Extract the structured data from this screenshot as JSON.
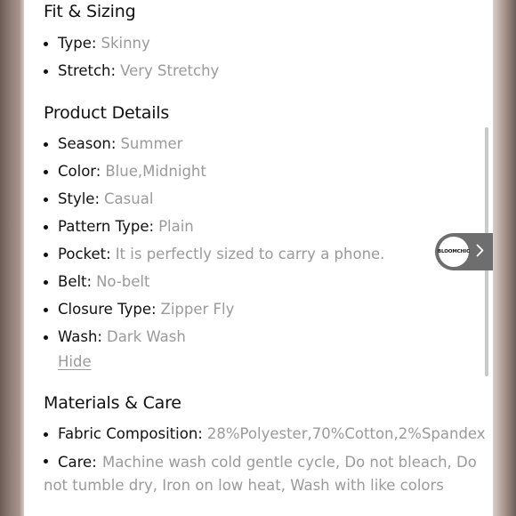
{
  "fit_sizing": {
    "title": "Fit & Sizing",
    "items": [
      {
        "label": "Type:",
        "value": "Skinny"
      },
      {
        "label": "Stretch:",
        "value": "Very Stretchy"
      }
    ]
  },
  "product_details": {
    "title": "Product Details",
    "items": [
      {
        "label": "Season:",
        "value": "Summer"
      },
      {
        "label": "Color:",
        "value": "Blue,Midnight"
      },
      {
        "label": "Style:",
        "value": "Casual"
      },
      {
        "label": "Pattern Type:",
        "value": "Plain"
      },
      {
        "label": "Pocket:",
        "value": "It is perfectly sized to carry a phone."
      },
      {
        "label": "Belt:",
        "value": "No-belt"
      },
      {
        "label": "Closure Type:",
        "value": "Zipper Fly"
      },
      {
        "label": "Wash:",
        "value": "Dark Wash"
      }
    ],
    "hide_label": "Hide"
  },
  "materials_care": {
    "title": "Materials & Care",
    "items": [
      {
        "label": "Fabric Composition:",
        "value": "28%Polyester,70%Cotton,2%Spandex"
      },
      {
        "label": "Care:",
        "value": "Machine wash cold gentle cycle, Do not bleach, Do not tumble dry, Iron on low heat, Wash with like colors"
      }
    ]
  },
  "floating_tab": {
    "brand": "BLOOMCHIC",
    "icon": "chevron-right-icon"
  }
}
